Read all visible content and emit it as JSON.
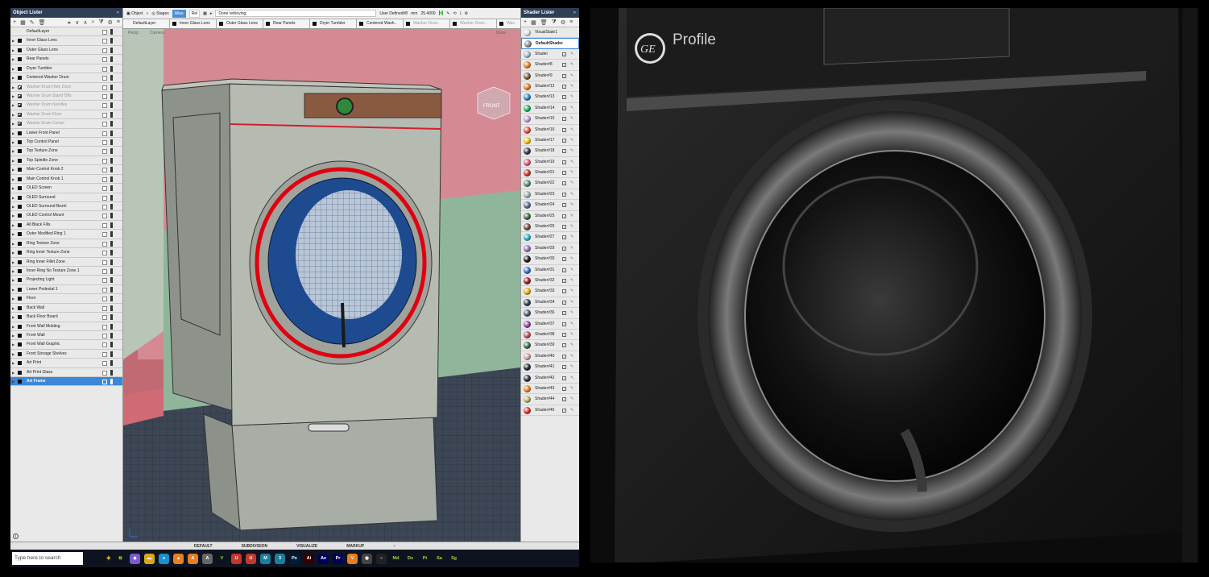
{
  "object_lister": {
    "title": "Object Lister",
    "close": "«",
    "items": [
      {
        "label": "DefaultLayer",
        "icon": "none",
        "dim": false,
        "sel": false,
        "arrow": false
      },
      {
        "label": "Inner Glass Lens",
        "icon": "square",
        "dim": false,
        "sel": false,
        "arrow": true
      },
      {
        "label": "Outer Glass Lens",
        "icon": "square",
        "dim": false,
        "sel": false,
        "arrow": true
      },
      {
        "label": "Rear Panels",
        "icon": "square",
        "dim": false,
        "sel": false,
        "arrow": true
      },
      {
        "label": "Dryer Tumbler",
        "icon": "square",
        "dim": false,
        "sel": false,
        "arrow": true
      },
      {
        "label": "Centered Washer Drum",
        "icon": "square",
        "dim": false,
        "sel": false,
        "arrow": true
      },
      {
        "label": "Washer Drum Hole Zone",
        "icon": "tri",
        "dim": true,
        "sel": false,
        "arrow": true
      },
      {
        "label": "Washer Drum Stand Offs",
        "icon": "tri",
        "dim": true,
        "sel": false,
        "arrow": true
      },
      {
        "label": "Washer Drum Noodles",
        "icon": "tri",
        "dim": true,
        "sel": false,
        "arrow": true
      },
      {
        "label": "Washer Drum Floor",
        "icon": "tri",
        "dim": true,
        "sel": false,
        "arrow": true
      },
      {
        "label": "Washer Drum Center",
        "icon": "tri",
        "dim": true,
        "sel": false,
        "arrow": true
      },
      {
        "label": "Lower Front Panel",
        "icon": "square",
        "dim": false,
        "sel": false,
        "arrow": true
      },
      {
        "label": "Top Control Panel",
        "icon": "square",
        "dim": false,
        "sel": false,
        "arrow": true
      },
      {
        "label": "Top Texture Zone",
        "icon": "square",
        "dim": false,
        "sel": false,
        "arrow": true
      },
      {
        "label": "Top Spindle Zone",
        "icon": "square",
        "dim": false,
        "sel": false,
        "arrow": true
      },
      {
        "label": "Main Control Knob 2",
        "icon": "square",
        "dim": false,
        "sel": false,
        "arrow": true
      },
      {
        "label": "Main Control Knob 1",
        "icon": "square",
        "dim": false,
        "sel": false,
        "arrow": true
      },
      {
        "label": "OLED Screen",
        "icon": "square",
        "dim": false,
        "sel": false,
        "arrow": true
      },
      {
        "label": "OLED Surround",
        "icon": "square",
        "dim": false,
        "sel": false,
        "arrow": true
      },
      {
        "label": "OLED Surround Bezel",
        "icon": "square",
        "dim": false,
        "sel": false,
        "arrow": true
      },
      {
        "label": "OLED Control Mount",
        "icon": "square",
        "dim": false,
        "sel": false,
        "arrow": true
      },
      {
        "label": "All Black Fills",
        "icon": "square",
        "dim": false,
        "sel": false,
        "arrow": true
      },
      {
        "label": "Outer Modified Ring 1",
        "icon": "square",
        "dim": false,
        "sel": false,
        "arrow": true
      },
      {
        "label": "Ring Texture Zone",
        "icon": "square",
        "dim": false,
        "sel": false,
        "arrow": true
      },
      {
        "label": "Ring Inner Texture Zone",
        "icon": "square",
        "dim": false,
        "sel": false,
        "arrow": true
      },
      {
        "label": "Ring Inner Fillet Zone",
        "icon": "square",
        "dim": false,
        "sel": false,
        "arrow": true
      },
      {
        "label": "Inner Ring No Texture Zone 1",
        "icon": "square",
        "dim": false,
        "sel": false,
        "arrow": true
      },
      {
        "label": "Projecting Light",
        "icon": "square",
        "dim": false,
        "sel": false,
        "arrow": true
      },
      {
        "label": "Lower Pedestal 1",
        "icon": "square",
        "dim": false,
        "sel": false,
        "arrow": true
      },
      {
        "label": "Floor",
        "icon": "square",
        "dim": false,
        "sel": false,
        "arrow": true
      },
      {
        "label": "Back Wall",
        "icon": "square",
        "dim": false,
        "sel": false,
        "arrow": true
      },
      {
        "label": "Back Floor Board",
        "icon": "square",
        "dim": false,
        "sel": false,
        "arrow": true
      },
      {
        "label": "Front Wall Molding",
        "icon": "square",
        "dim": false,
        "sel": false,
        "arrow": true
      },
      {
        "label": "Front Wall",
        "icon": "square",
        "dim": false,
        "sel": false,
        "arrow": true
      },
      {
        "label": "Front Wall Graphic",
        "icon": "square",
        "dim": false,
        "sel": false,
        "arrow": true
      },
      {
        "label": "Front Storage Shelves",
        "icon": "square",
        "dim": false,
        "sel": false,
        "arrow": true
      },
      {
        "label": "Art Print",
        "icon": "square",
        "dim": false,
        "sel": false,
        "arrow": true
      },
      {
        "label": "Art Print Glass",
        "icon": "square",
        "dim": false,
        "sel": false,
        "arrow": true
      },
      {
        "label": "Art Frame",
        "icon": "square",
        "dim": false,
        "sel": true,
        "arrow": true
      }
    ]
  },
  "toolbar": {
    "object": "Object",
    "stages": "Stages",
    "alias": "Alias",
    "rel": "Rel",
    "status": "Done retrieving.",
    "user_defined": "User Defined#8",
    "units": "mm",
    "value": "25.4000",
    "h": "H"
  },
  "layer_tabs": [
    {
      "label": "DefaultLayer",
      "dim": false,
      "sq": false
    },
    {
      "label": "Inner Glass Lens",
      "dim": false,
      "sq": true
    },
    {
      "label": "Outer Glass Lens",
      "dim": false,
      "sq": true
    },
    {
      "label": "Rear Panels",
      "dim": false,
      "sq": true
    },
    {
      "label": "Dryer Tumbler",
      "dim": false,
      "sq": true
    },
    {
      "label": "Centered Wash..",
      "dim": false,
      "sq": true
    },
    {
      "label": "Washer Drum ..",
      "dim": true,
      "sq": true
    },
    {
      "label": "Washer Drum ..",
      "dim": true,
      "sq": true
    },
    {
      "label": "Was",
      "dim": true,
      "sq": true
    }
  ],
  "viewport": {
    "menu_left": "Persp",
    "menu_mid": "Camera",
    "show": "Show",
    "view_cube": "FRONT"
  },
  "shader_lister": {
    "title": "Shader Lister",
    "close": "»",
    "items": [
      {
        "label": "VisualState1",
        "color": "#dddddd",
        "def": false
      },
      {
        "label": "DefaultShader",
        "color": "#8c8c8c",
        "def": true
      },
      {
        "label": "Shader",
        "color": "#9ac0c8",
        "def": false
      },
      {
        "label": "Shader#8",
        "color": "#e67e22",
        "def": false
      },
      {
        "label": "Shader#9",
        "color": "#7b5a3a",
        "def": false
      },
      {
        "label": "Shader#12",
        "color": "#e67e22",
        "def": false
      },
      {
        "label": "Shader#13",
        "color": "#2e86c1",
        "def": false
      },
      {
        "label": "Shader#14",
        "color": "#27ae60",
        "def": false
      },
      {
        "label": "Shader#15",
        "color": "#c39bd3",
        "def": false
      },
      {
        "label": "Shader#16",
        "color": "#e74c3c",
        "def": false
      },
      {
        "label": "Shader#17",
        "color": "#f1c40f",
        "def": false
      },
      {
        "label": "Shader#18",
        "color": "#2c3e50",
        "def": false
      },
      {
        "label": "Shader#19",
        "color": "#e05a7a",
        "def": false
      },
      {
        "label": "Shader#21",
        "color": "#c0392b",
        "def": false
      },
      {
        "label": "Shader#22",
        "color": "#5d8a6a",
        "def": false
      },
      {
        "label": "Shader#23",
        "color": "#a0a8b0",
        "def": false
      },
      {
        "label": "Shader#24",
        "color": "#5b6d8f",
        "def": false
      },
      {
        "label": "Shader#25",
        "color": "#3f6b3f",
        "def": false
      },
      {
        "label": "Shader#26",
        "color": "#6b4f3a",
        "def": false
      },
      {
        "label": "Shader#27",
        "color": "#2eaec4",
        "def": false
      },
      {
        "label": "Shader#29",
        "color": "#8e6bc0",
        "def": false
      },
      {
        "label": "Shader#30",
        "color": "#1a1a1a",
        "def": false
      },
      {
        "label": "Shader#31",
        "color": "#2f6fd0",
        "def": false
      },
      {
        "label": "Shader#32",
        "color": "#a01828",
        "def": false
      },
      {
        "label": "Shader#33",
        "color": "#e6a817",
        "def": false
      },
      {
        "label": "Shader#34",
        "color": "#2c3e50",
        "def": false
      },
      {
        "label": "Shader#36",
        "color": "#4a5a6a",
        "def": false
      },
      {
        "label": "Shader#37",
        "color": "#8e44ad",
        "def": false
      },
      {
        "label": "Shader#38",
        "color": "#b05060",
        "def": false
      },
      {
        "label": "Shader#39",
        "color": "#3a6a4a",
        "def": false
      },
      {
        "label": "Shader#40",
        "color": "#caa0a0",
        "def": false
      },
      {
        "label": "Shader#41",
        "color": "#222a3a",
        "def": false
      },
      {
        "label": "Shader#42",
        "color": "#2a3446",
        "def": false
      },
      {
        "label": "Shader#43",
        "color": "#e67e22",
        "def": false
      },
      {
        "label": "Shader#44",
        "color": "#b0b070",
        "def": false
      },
      {
        "label": "Shader#45",
        "color": "#e03030",
        "def": false
      }
    ]
  },
  "bottom_tabs": [
    "DEFAULT",
    "SUBDIVISION",
    "VISUALIZE",
    "MARKUP",
    "+"
  ],
  "taskbar": {
    "search_placeholder": "Type here to search",
    "icons": [
      {
        "name": "task-view-icon",
        "label": "⧉",
        "color": "#0e1320"
      },
      {
        "name": "copilot-icon",
        "label": "◆",
        "color": "#7a5ccf"
      },
      {
        "name": "file-explorer-icon",
        "label": "▬",
        "color": "#d9a520"
      },
      {
        "name": "edge-icon",
        "label": "e",
        "color": "#1b8fd0"
      },
      {
        "name": "vlc-icon",
        "label": "▲",
        "color": "#e67e22"
      },
      {
        "name": "alias-icon",
        "label": "A",
        "color": "#e67e22"
      },
      {
        "name": "alias-2-icon",
        "label": "A",
        "color": "#666"
      },
      {
        "name": "vred-icon",
        "label": "V",
        "color": "#0e1320"
      },
      {
        "name": "app-orange-icon",
        "label": "U",
        "color": "#c0392b"
      },
      {
        "name": "app-orange-2-icon",
        "label": "U",
        "color": "#c0392b"
      },
      {
        "name": "maya-icon",
        "label": "M",
        "color": "#1a7f9c"
      },
      {
        "name": "3ds-max-icon",
        "label": "3",
        "color": "#1a7f9c"
      },
      {
        "name": "photoshop-icon",
        "label": "Ps",
        "color": "#001e36"
      },
      {
        "name": "illustrator-icon",
        "label": "Ai",
        "color": "#330000"
      },
      {
        "name": "after-effects-icon",
        "label": "Ae",
        "color": "#00005b"
      },
      {
        "name": "premiere-icon",
        "label": "Pr",
        "color": "#00005b"
      },
      {
        "name": "vlc-2-icon",
        "label": "V",
        "color": "#e67e22"
      },
      {
        "name": "keyshot-icon",
        "label": "◉",
        "color": "#444"
      },
      {
        "name": "obs-icon",
        "label": "○",
        "color": "#222"
      },
      {
        "name": "md-icon",
        "label": "Md",
        "color": "#0e1320"
      },
      {
        "name": "ds-icon",
        "label": "Ds",
        "color": "#0e1320"
      },
      {
        "name": "pt-icon",
        "label": "Pt",
        "color": "#0e1320"
      },
      {
        "name": "sa-icon",
        "label": "Sa",
        "color": "#0e1320"
      },
      {
        "name": "sg-icon",
        "label": "Sg",
        "color": "#0e1320"
      }
    ]
  },
  "render": {
    "brand": "Profile",
    "logo": "GE"
  }
}
